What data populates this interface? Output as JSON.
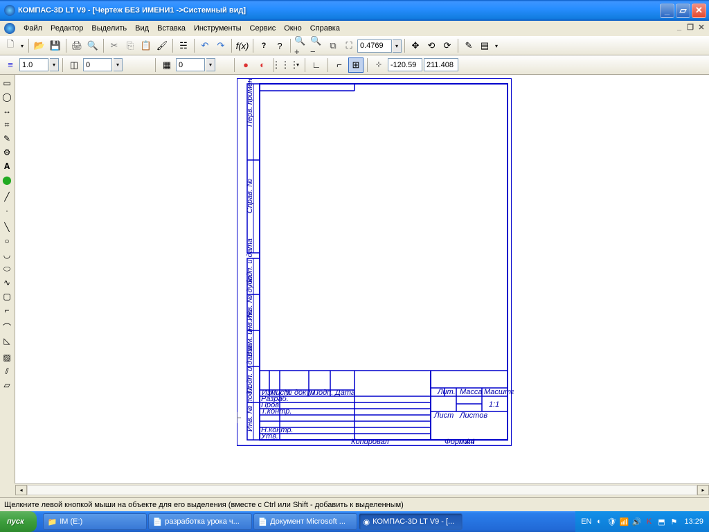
{
  "titlebar": {
    "text": "КОМПАС-3D LT V9 - [Чертеж БЕЗ ИМЕНИ1 ->Системный вид]"
  },
  "menu": {
    "file": "Файл",
    "edit": "Редактор",
    "select": "Выделить",
    "view": "Вид",
    "insert": "Вставка",
    "instruments": "Инструменты",
    "service": "Сервис",
    "window": "Окно",
    "help": "Справка"
  },
  "toolbar2": {
    "zoom_value": "0.4769"
  },
  "propbar": {
    "style": "1.0",
    "layer": "0",
    "hatch": "0",
    "coord_x": "-120.59",
    "coord_y": "211.408"
  },
  "titleblock": {
    "col1": "Изм.",
    "col2": "Лист",
    "col3": "№ докум.",
    "col4": "Подп.",
    "col5": "Дата",
    "row_razrab": "Разраб.",
    "row_prov": "Пров.",
    "row_tkontr": "Т.контр.",
    "row_nkontr": "Н.контр.",
    "row_utv": "Утв.",
    "lit": "Лит.",
    "massa": "Масса",
    "mashtab": "Масштаб",
    "mashtab_val": "1:1",
    "list": "Лист",
    "listov": "Листов",
    "kopiroval": "Копировал",
    "format": "Формат",
    "format_val": "А4"
  },
  "sideblock": {
    "perv": "Перв. примен.",
    "sprav": "Справ. №",
    "podp_data1": "Подп. и дата",
    "inv_dubl": "Инв. № дубл.",
    "vzam_inv": "Взам. инв. №",
    "podp_data2": "Подп. и дата",
    "inv_podl": "Инв. № подл."
  },
  "status": {
    "hint": "Щелкните левой кнопкой мыши на объекте для его выделения (вместе с Ctrl или Shift - добавить к выделенным)"
  },
  "taskbar": {
    "start": "пуск",
    "t1": "IM (E:)",
    "t2": "разработка урока ч...",
    "t3": "Документ Microsoft ...",
    "t4": "КОМПАС-3D LT V9 - [...",
    "lang": "EN",
    "clock": "13:29"
  }
}
